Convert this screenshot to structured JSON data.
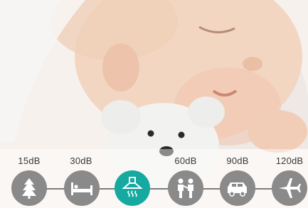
{
  "noise_levels": [
    {
      "label": "15dB",
      "icon": "leaves-icon",
      "active": false
    },
    {
      "label": "30dB",
      "icon": "bed-icon",
      "active": false
    },
    {
      "label": "",
      "icon": "range-hood-icon",
      "active": true
    },
    {
      "label": "60dB",
      "icon": "people-talking-icon",
      "active": false
    },
    {
      "label": "90dB",
      "icon": "car-icon",
      "active": false
    },
    {
      "label": "120dB",
      "icon": "airplane-icon",
      "active": false
    }
  ],
  "colors": {
    "active": "#15a9a0",
    "inactive": "#8a8a8a",
    "connector": "#7d7d7d",
    "label": "#3a3a3a"
  }
}
